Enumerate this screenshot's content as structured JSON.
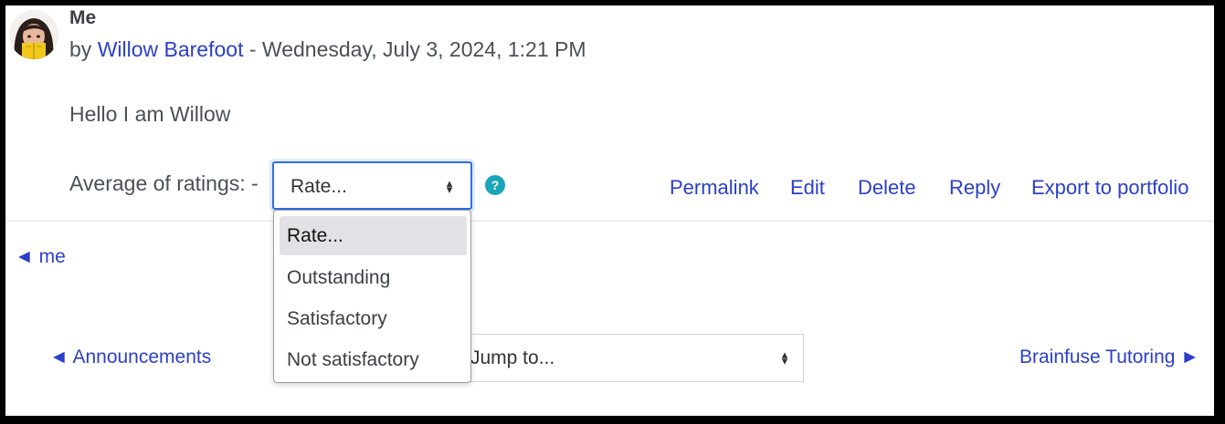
{
  "post": {
    "title": "Me",
    "by_prefix": "by",
    "author": "Willow Barefoot",
    "date_sep": " - ",
    "date": "Wednesday, July 3, 2024, 1:21 PM",
    "content": "Hello I am Willow"
  },
  "rating": {
    "label": "Average of ratings: -",
    "select_value": "Rate...",
    "options": [
      "Rate...",
      "Outstanding",
      "Satisfactory",
      "Not satisfactory"
    ],
    "selected_index": 0,
    "help_icon": "question-circle-icon",
    "help_glyph": "?"
  },
  "commands": {
    "permalink": "Permalink",
    "edit": "Edit",
    "delete": "Delete",
    "reply": "Reply",
    "export": "Export to portfolio"
  },
  "nav": {
    "prev_discussion": "◄ me",
    "prev_activity": "◄ Announcements",
    "jump_placeholder": "Jump to...",
    "next_activity": "Brainfuse Tutoring ►"
  },
  "colors": {
    "link": "#2b3fc9",
    "focus": "#2f6fe0",
    "help": "#1aa5b8",
    "text": "#495057"
  }
}
